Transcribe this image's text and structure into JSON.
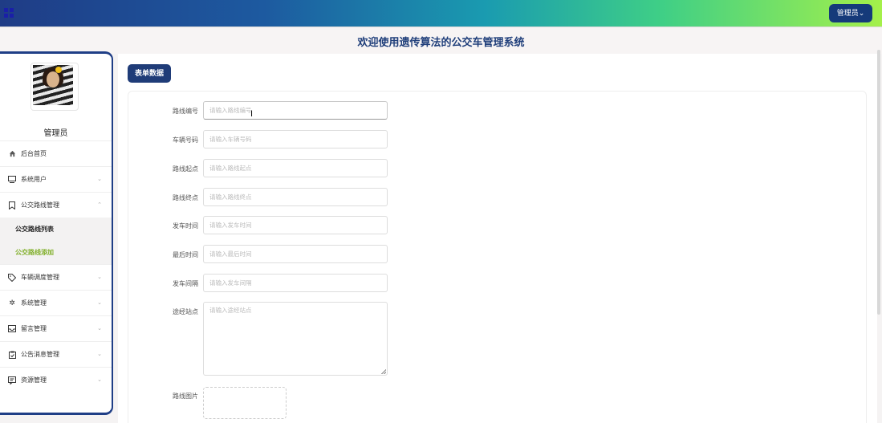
{
  "header": {
    "admin_button": "管理员⌄",
    "site_title": "欢迎使用遗传算法的公交车管理系统"
  },
  "sidebar": {
    "username": "管理员",
    "items": [
      {
        "icon": "home-icon",
        "label": "后台首页"
      },
      {
        "icon": "monitor-icon",
        "label": "系统用户",
        "chevron": "⌄"
      },
      {
        "icon": "bookmark-icon",
        "label": "公交路线管理",
        "chevron": "⌃"
      },
      {
        "icon": "tag-icon",
        "label": "车辆调度管理",
        "chevron": "⌄"
      },
      {
        "icon": "gear-icon",
        "label": "系统管理",
        "chevron": "⌄"
      },
      {
        "icon": "inbox-icon",
        "label": "留言管理",
        "chevron": "⌄"
      },
      {
        "icon": "clipboard-icon",
        "label": "公告消息管理",
        "chevron": "⌄"
      },
      {
        "icon": "chat-icon",
        "label": "资源管理",
        "chevron": "⌄"
      }
    ],
    "sub_items": [
      {
        "label": "公交路线列表"
      },
      {
        "label": "公交路线添加"
      }
    ]
  },
  "form": {
    "tab_label": "表单数据",
    "fields": [
      {
        "label": "路线编号",
        "placeholder": "请输入路线编号"
      },
      {
        "label": "车辆号码",
        "placeholder": "请输入车辆号码"
      },
      {
        "label": "路线起点",
        "placeholder": "请输入路线起点"
      },
      {
        "label": "路线终点",
        "placeholder": "请输入路线终点"
      },
      {
        "label": "发车时间",
        "placeholder": "请输入发车时间"
      },
      {
        "label": "最后时间",
        "placeholder": "请输入最后时间"
      },
      {
        "label": "发车间隔",
        "placeholder": "请输入发车间隔"
      }
    ],
    "textarea": {
      "label": "途经站点",
      "placeholder": "请输入途经站点"
    },
    "upload": {
      "label": "路线图片"
    }
  },
  "colors": {
    "primary": "#1f3c78",
    "active_submenu": "#82b02c"
  }
}
